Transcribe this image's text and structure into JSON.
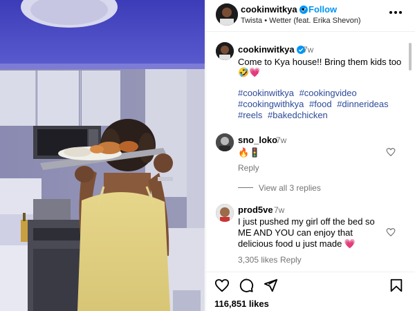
{
  "post": {
    "username": "cookinwitkya",
    "follow_label": "Follow",
    "separator": "•",
    "audio": "Twista • Wetter (feat. Erika Shevon)"
  },
  "caption": {
    "username": "cookinwitkya",
    "time": "7w",
    "text": "Come to Kya house!! Bring them kids too",
    "emojis": "🤣💗",
    "hashtags": [
      "#cookinwitkya",
      "#cookingvideo",
      "#cookingwithkya",
      "#food",
      "#dinnerideas",
      "#reels",
      "#bakedchicken"
    ]
  },
  "comments": [
    {
      "username": "sno_loko",
      "time": "7w",
      "text": "🔥🚦",
      "reply_label": "Reply"
    },
    {
      "username": "prod5ve",
      "time": "7w",
      "text": "I just pushed my girl off the bed so ME AND YOU can enjoy that delicious food u just made 💗",
      "likes": "3,305 likes",
      "reply_label": "Reply"
    }
  ],
  "view_replies": "View all 3 replies",
  "likes_count": "116,851 likes",
  "colors": {
    "accent": "#0095f6",
    "hashtag": "#2c4a9a",
    "muted": "#737373"
  },
  "icons": [
    "verified-badge-icon",
    "more-options-icon",
    "heart-icon",
    "comment-icon",
    "share-icon",
    "bookmark-icon"
  ]
}
